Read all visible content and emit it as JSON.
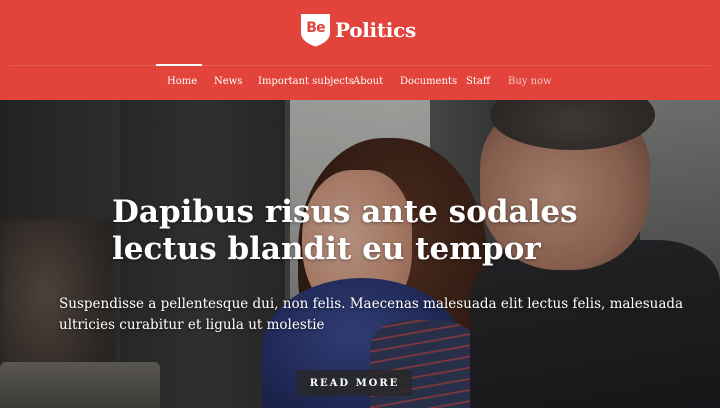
{
  "header": {
    "logo_badge": "Be",
    "logo_text": "Politics",
    "brand_color": "#e2443b"
  },
  "nav": {
    "items": [
      {
        "label": "Home",
        "active": true
      },
      {
        "label": "News"
      },
      {
        "label": "Important subjects"
      },
      {
        "label": "About"
      },
      {
        "label": "Documents"
      },
      {
        "label": "Staff"
      },
      {
        "label": "Buy now"
      }
    ]
  },
  "hero": {
    "title": "Dapibus risus ante sodales lectus blandit eu tempor",
    "text": "Suspendisse a pellentesque dui, non felis. Maecenas malesuada elit lectus felis, malesuada ultricies curabitur et ligula ut molestie",
    "button_label": "READ MORE",
    "image": "photo of a woman and man in a conference"
  }
}
